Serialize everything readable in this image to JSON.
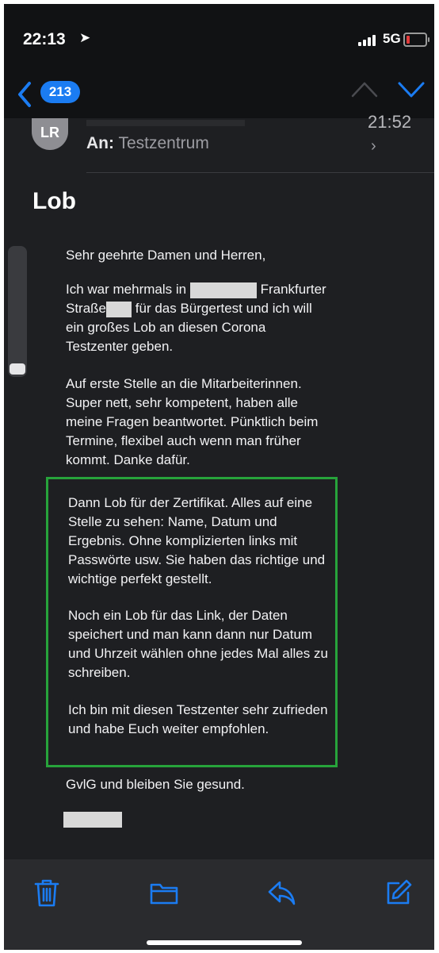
{
  "status_bar": {
    "time": "22:13",
    "location_icon": "location-arrow-icon",
    "network": "5G",
    "battery_level": 0.15,
    "battery_color": "#e23b3b"
  },
  "nav": {
    "back_icon": "chevron-left-icon",
    "unread_count": "213",
    "accent_color": "#1b7cf2",
    "previous_icon": "chevron-up-icon",
    "next_icon": "chevron-down-icon"
  },
  "message_header": {
    "avatar_initials": "LR",
    "time": "21:52",
    "to_label": "An:",
    "to_value": "Testzentrum",
    "detail_icon": "chevron-right-icon"
  },
  "email": {
    "subject": "Lob",
    "greeting": "Sehr geehrte Damen und Herren,",
    "p2_part1": "Ich war mehrmals in",
    "p2_part2": "Frankfurter Straße",
    "p2_part3": "für das Bürgertest und ich will ein großes Lob an diesen Corona Testzenter geben.",
    "p3": "Auf erste Stelle an die Mitarbeiterinnen. Super nett, sehr kompetent, haben alle meine Fragen beantwortet. Pünktlich beim Termine, flexibel auch wenn man früher kommt. Danke dafür.",
    "highlight_p1": "Dann Lob für der Zertifikat. Alles auf eine Stelle zu sehen: Name, Datum und Ergebnis.  Ohne komplizierten links mit Passwörte usw.  Sie haben das richtige und wichtige perfekt gestellt.",
    "highlight_p2": "Noch ein Lob für das Link, der Daten speichert und man kann dann nur Datum und Uhrzeit wählen ohne jedes Mal alles zu schreiben.",
    "highlight_p3": "Ich bin mit diesen Testzenter sehr zufrieden und habe Euch weiter empfohlen.",
    "highlight_color": "#27a33b",
    "closing": "GvlG und bleiben Sie gesund."
  },
  "toolbar": {
    "items": [
      "trash-icon",
      "folder-icon",
      "reply-icon",
      "compose-icon"
    ],
    "icon_color": "#1b7cf2"
  }
}
